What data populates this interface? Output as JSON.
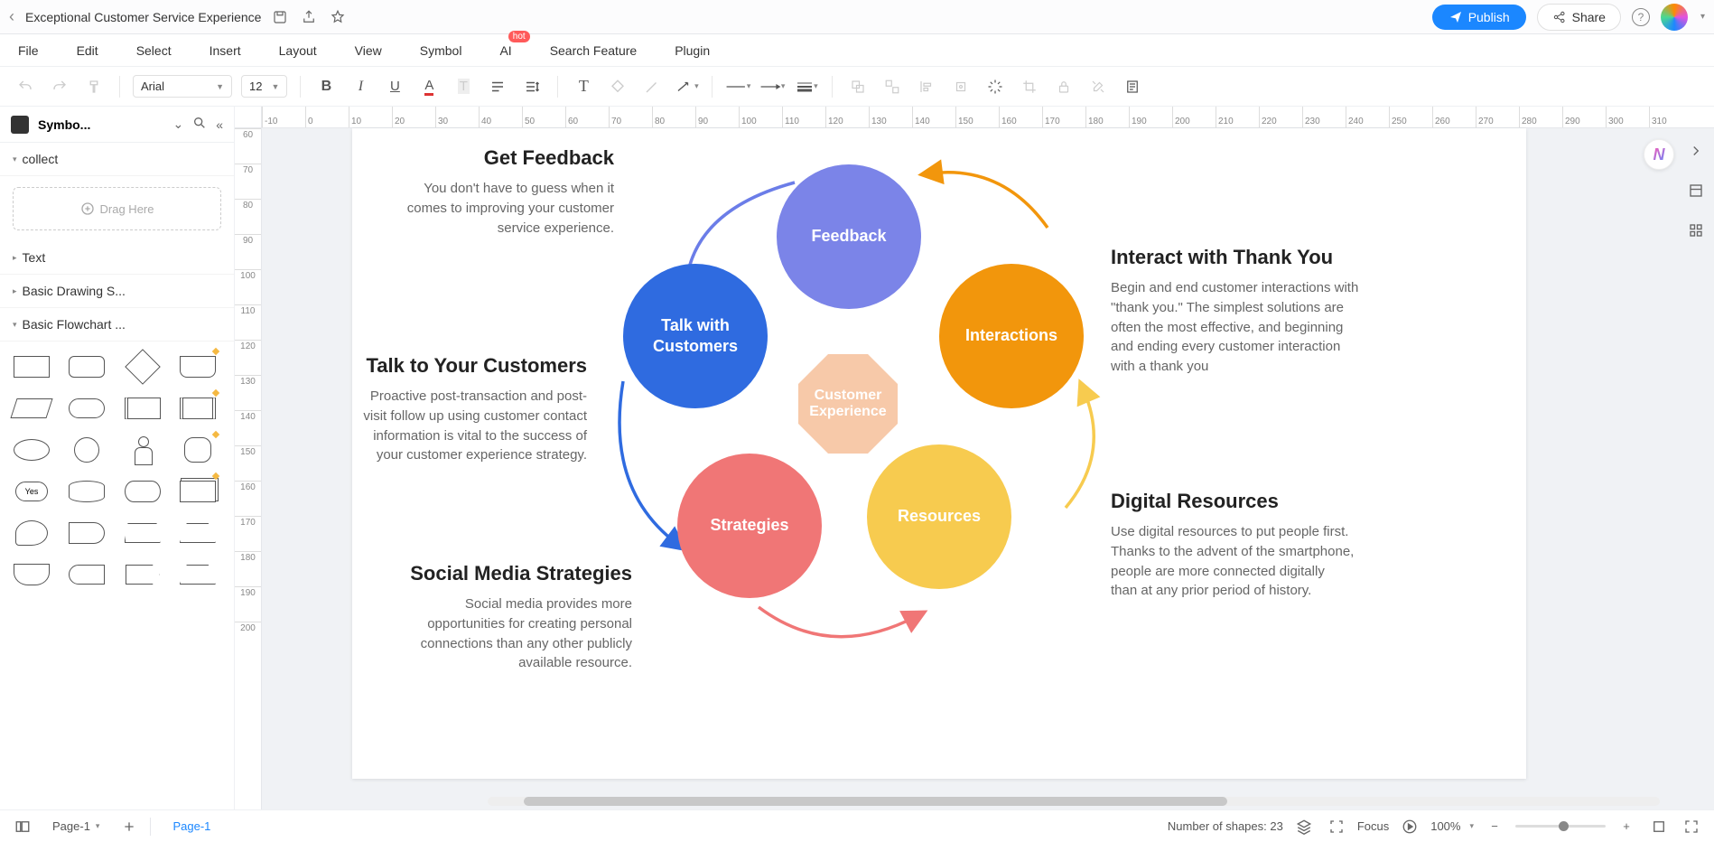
{
  "doc_title": "Exceptional Customer Service Experience",
  "topbar": {
    "publish": "Publish",
    "share": "Share",
    "help": "?"
  },
  "menu": {
    "file": "File",
    "edit": "Edit",
    "select": "Select",
    "insert": "Insert",
    "layout": "Layout",
    "view": "View",
    "symbol": "Symbol",
    "ai": "AI",
    "ai_badge": "hot",
    "search": "Search Feature",
    "plugin": "Plugin"
  },
  "toolbar": {
    "font": "Arial",
    "size": "12"
  },
  "left": {
    "title": "Symbo...",
    "sections": {
      "collect": "collect",
      "drag": "Drag Here",
      "text": "Text",
      "basic_drawing": "Basic Drawing S...",
      "basic_flowchart": "Basic Flowchart ..."
    },
    "yes_label": "Yes"
  },
  "ruler_h": [
    "-10",
    "0",
    "10",
    "20",
    "30",
    "40",
    "50",
    "60",
    "70",
    "80",
    "90",
    "100",
    "110",
    "120",
    "130",
    "140",
    "150",
    "160",
    "170",
    "180",
    "190",
    "200",
    "210",
    "220",
    "230",
    "240",
    "250",
    "260",
    "270",
    "280",
    "290",
    "300",
    "310"
  ],
  "ruler_v": [
    "60",
    "70",
    "80",
    "90",
    "100",
    "110",
    "120",
    "130",
    "140",
    "150",
    "160",
    "170",
    "180",
    "190",
    "200"
  ],
  "diagram": {
    "center": "Customer\nExperience",
    "nodes": {
      "feedback": {
        "label": "Feedback",
        "color": "#7b84e8"
      },
      "interactions": {
        "label": "Interactions",
        "color": "#f2960c"
      },
      "resources": {
        "label": "Resources",
        "color": "#f7cb4f"
      },
      "strategies": {
        "label": "Strategies",
        "color": "#f07676"
      },
      "talk": {
        "label": "Talk with\nCustomers",
        "color": "#2f6be0"
      }
    },
    "captions": {
      "feedback": {
        "title": "Get Feedback",
        "body": "You don't have to guess when it comes to improving your customer service experience."
      },
      "interactions": {
        "title": "Interact with Thank You",
        "body": "Begin and end customer interactions with \"thank you.\" The simplest solutions are often the most effective, and beginning and ending every customer interaction with a thank you"
      },
      "resources": {
        "title": "Digital Resources",
        "body": "Use digital resources to put people first. Thanks to the advent of the smartphone, people are more connected digitally than at any prior period of history."
      },
      "strategies": {
        "title": "Social Media Strategies",
        "body": "Social media provides more opportunities for creating personal connections than any other publicly available resource."
      },
      "talk": {
        "title": "Talk to Your Customers",
        "body": "Proactive post-transaction and post-visit follow up using customer contact information is vital to the success of your customer experience strategy."
      }
    }
  },
  "status": {
    "page_sel": "Page-1",
    "page_tab": "Page-1",
    "shapes": "Number of shapes: 23",
    "focus": "Focus",
    "zoom": "100%"
  }
}
